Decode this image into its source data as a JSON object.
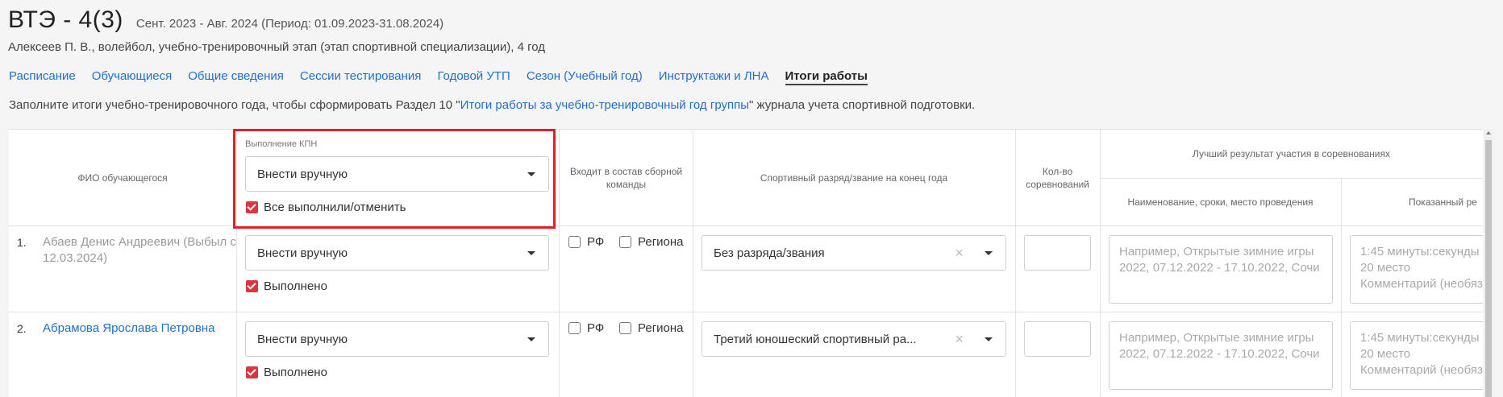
{
  "header": {
    "title": "ВТЭ - 4(3)",
    "period": "Сент. 2023 - Авг. 2024 (Период: 01.09.2023-31.08.2024)",
    "subtitle": "Алексеев П. В., волейбол, учебно-тренировочный этап (этап спортивной специализации), 4 год"
  },
  "tabs": [
    {
      "label": "Расписание",
      "active": false
    },
    {
      "label": "Обучающиеся",
      "active": false
    },
    {
      "label": "Общие сведения",
      "active": false
    },
    {
      "label": "Сессии тестирования",
      "active": false
    },
    {
      "label": "Годовой УТП",
      "active": false
    },
    {
      "label": "Сезон (Учебный год)",
      "active": false
    },
    {
      "label": "Инструктажи и ЛНА",
      "active": false
    },
    {
      "label": "Итоги работы",
      "active": true
    }
  ],
  "note": {
    "before": "Заполните итоги учебно-тренировочного года, чтобы сформировать Раздел 10 \"",
    "link": "Итоги работы за учебно-тренировочный год группы",
    "after": "\" журнала учета спортивной подготовки."
  },
  "columns": {
    "name": "ФИО обучающегося",
    "kpn": "Выполнение КПН",
    "team": "Входит в состав сборной команды",
    "rank": "Спортивный разряд/звание на конец года",
    "count": "Кол-во соревнований",
    "best": "Лучший результат участия в соревнованиях",
    "best_name": "Наименование, сроки, место проведения",
    "best_result": "Показанный ре"
  },
  "kpn_header": {
    "select_value": "Внести вручную",
    "all_label": "Все выполнили/отменить",
    "all_checked": true
  },
  "rows": [
    {
      "num": "1.",
      "name": "Абаев Денис Андреевич (Выбыл с 12.03.2024)",
      "name_style": "grey",
      "kpn_value": "Внести вручную",
      "kpn_done_label": "Выполнено",
      "kpn_done": true,
      "rf_label": "РФ",
      "region_label": "Региона",
      "rank_value": "Без разряда/звания",
      "competition_placeholder": "Например, Открытые зимние игры 2022, 07.12.2022 - 17.10.2022, Сочи",
      "result_placeholder": "1:45 минуты:секунды 20 место Комментарий (необяз"
    },
    {
      "num": "2.",
      "name": "Абрамова Ярослава Петровна",
      "name_style": "link",
      "kpn_value": "Внести вручную",
      "kpn_done_label": "Выполнено",
      "kpn_done": true,
      "rf_label": "РФ",
      "region_label": "Региона",
      "rank_value": "Третий юношеский спортивный ра...",
      "competition_placeholder": "Например, Открытые зимние игры 2022, 07.12.2022 - 17.10.2022, Сочи",
      "result_placeholder": "1:45 минуты:секунды 20 место Комментарий (необяз"
    }
  ],
  "colors": {
    "link": "#1f6fd1",
    "checkbox": "#d9363e",
    "highlight": "#e3202a"
  }
}
